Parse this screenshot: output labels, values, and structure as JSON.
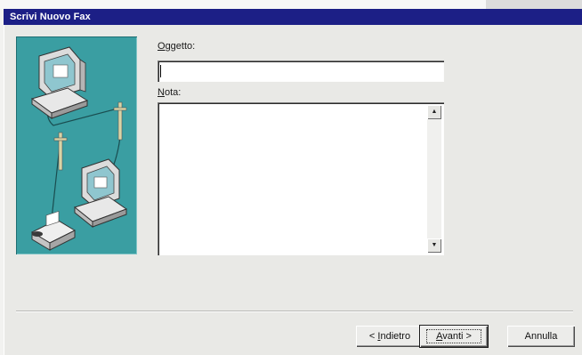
{
  "window": {
    "title": "Scrivi Nuovo Fax"
  },
  "form": {
    "subject_label_mnemonic": "O",
    "subject_label_rest": "ggetto:",
    "subject_value": "",
    "note_label_mnemonic": "N",
    "note_label_rest": "ota:",
    "note_value": ""
  },
  "scrollbar": {
    "up_glyph": "▲",
    "down_glyph": "▼"
  },
  "buttons": {
    "back_prefix": "< ",
    "back_mnemonic": "I",
    "back_rest": "ndietro",
    "next_mnemonic": "A",
    "next_rest": "vanti >",
    "cancel": "Annulla"
  },
  "illustration": {
    "icons": [
      "computer-icon",
      "computer-icon",
      "fax-machine-icon",
      "telephone-pole-icon",
      "telephone-pole-icon"
    ]
  }
}
